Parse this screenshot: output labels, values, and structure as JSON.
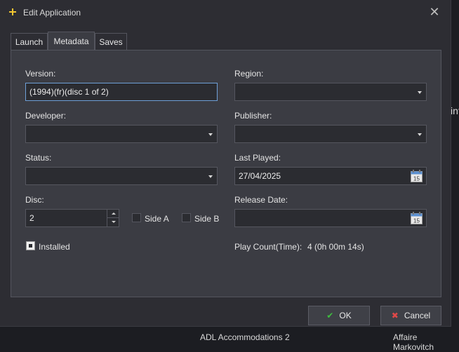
{
  "window": {
    "title": "Edit Application",
    "close_glyph": "✕"
  },
  "tabs": [
    {
      "label": "Launch"
    },
    {
      "label": "Metadata"
    },
    {
      "label": "Saves"
    }
  ],
  "form": {
    "version": {
      "label": "Version:",
      "value": "(1994)(fr)(disc 1 of 2)"
    },
    "region": {
      "label": "Region:",
      "value": ""
    },
    "developer": {
      "label": "Developer:",
      "value": ""
    },
    "publisher": {
      "label": "Publisher:",
      "value": ""
    },
    "status": {
      "label": "Status:",
      "value": ""
    },
    "last_played": {
      "label": "Last Played:",
      "value": "27/04/2025"
    },
    "disc": {
      "label": "Disc:",
      "value": "2"
    },
    "side_a": {
      "label": "Side A",
      "checked": false
    },
    "side_b": {
      "label": "Side B",
      "checked": false
    },
    "release_date": {
      "label": "Release Date:",
      "value": ""
    },
    "installed": {
      "label": "Installed",
      "checked": true
    },
    "play_count": {
      "label": "Play Count(Time):",
      "value": "4 (0h 00m 14s)"
    },
    "calendar_day": "15"
  },
  "buttons": {
    "ok": {
      "label": "OK",
      "icon": "check-icon",
      "icon_glyph": "✔"
    },
    "cancel": {
      "label": "Cancel",
      "icon": "cancel-icon",
      "icon_glyph": "✖"
    }
  },
  "background_fragments": {
    "right_edge_text": "int",
    "bottom_left_text": "ADL Accommodations 2",
    "bottom_right_text": "Affaire Markovitch"
  },
  "colors": {
    "accent_focus": "#6fa0d8",
    "ok_icon": "#3fbf3f",
    "cancel_icon": "#e04848",
    "app_icon": "#f2c531"
  }
}
